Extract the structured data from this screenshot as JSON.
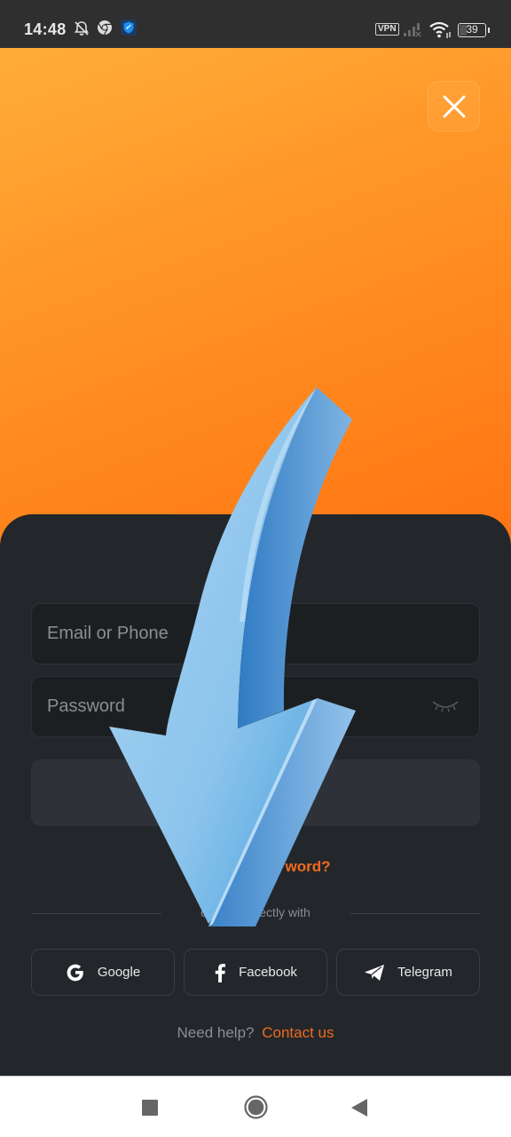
{
  "status_bar": {
    "time": "14:48",
    "vpn_label": "VPN",
    "battery_level": "39",
    "icons": [
      "bell-off-icon",
      "chrome-icon",
      "shield-app-icon",
      "vpn-icon",
      "signal-icon",
      "wifi-icon",
      "battery-icon"
    ]
  },
  "hero": {
    "background_colors": [
      "#ffad3a",
      "#ff7414"
    ],
    "close_icon": "close-icon"
  },
  "login_form": {
    "email_placeholder": "Email or Phone",
    "email_value": "",
    "password_placeholder": "Password",
    "password_value": "",
    "password_toggle_icon": "eye-closed-icon",
    "submit_label": "",
    "forgot_password_visible": "word?",
    "divider_text_visible": "o               ectly with"
  },
  "social": [
    {
      "label": "Google",
      "icon": "google-icon"
    },
    {
      "label": "Facebook",
      "icon": "facebook-icon"
    },
    {
      "label": "Telegram",
      "icon": "telegram-icon"
    }
  ],
  "help": {
    "text": "Need help?",
    "link": "Contact us"
  },
  "colors": {
    "accent": "#f06a1c",
    "sheet_bg": "#23272b",
    "field_bg": "#1c1f22"
  },
  "overlay": {
    "icon": "down-arrow-overlay-icon"
  },
  "nav_bar": {
    "buttons": [
      "recents-button",
      "home-button",
      "back-button"
    ]
  }
}
